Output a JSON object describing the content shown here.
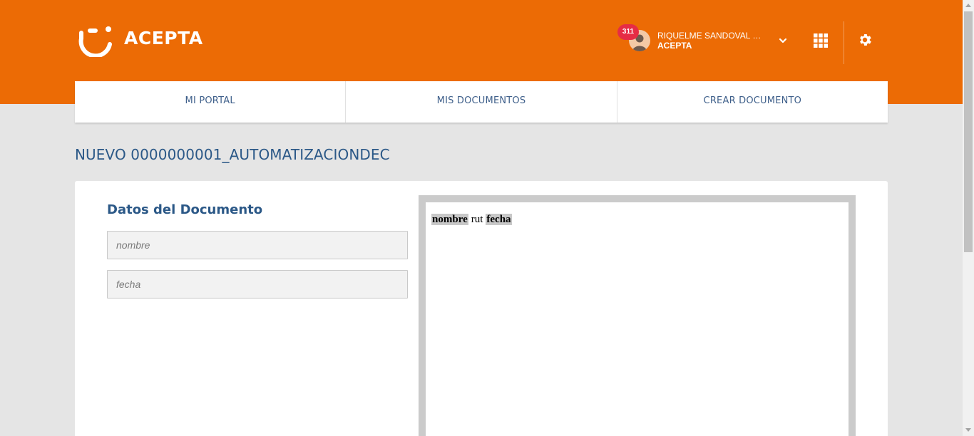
{
  "header": {
    "brand": "ACEPTA",
    "logo_icon": "acepta-smile-logo",
    "notification_count": "311",
    "user_name": "RIQUELME SANDOVAL RU...",
    "user_org": "ACEPTA",
    "accent_color": "#ec6b05",
    "badge_color": "#e62c45"
  },
  "nav": {
    "items": [
      {
        "label": "MI PORTAL"
      },
      {
        "label": "MIS DOCUMENTOS"
      },
      {
        "label": "CREAR DOCUMENTO"
      }
    ]
  },
  "page": {
    "title": "NUEVO 0000000001_AUTOMATIZACIONDEC"
  },
  "form": {
    "section_title": "Datos del Documento",
    "fields": [
      {
        "placeholder": "nombre",
        "value": ""
      },
      {
        "placeholder": "fecha",
        "value": ""
      }
    ]
  },
  "preview": {
    "tokens": [
      {
        "text": "nombre",
        "highlighted": true
      },
      {
        "text": "rut",
        "highlighted": false
      },
      {
        "text": "fecha",
        "highlighted": true
      }
    ]
  }
}
